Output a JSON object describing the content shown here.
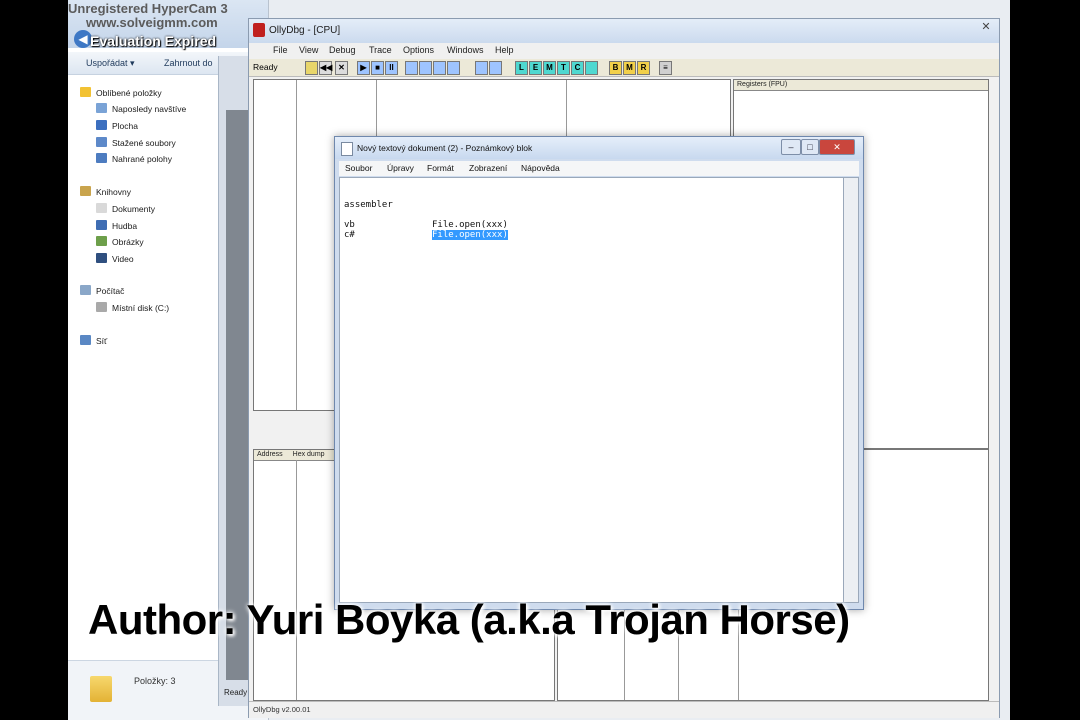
{
  "watermark": {
    "line1": "Unregistered HyperCam 3",
    "line2": "www.solveigmm.com",
    "line3": "Evaluation Expired"
  },
  "explorer": {
    "toolbar": {
      "organize": "Uspořádat ▾",
      "include": "Zahrnout do"
    },
    "favorites_header": "Oblíbené položky",
    "favorites": [
      "Naposledy navštíve",
      "Plocha",
      "Stažené soubory",
      "Nahrané polohy"
    ],
    "libraries_header": "Knihovny",
    "libraries": [
      "Dokumenty",
      "Hudba",
      "Obrázky",
      "Video"
    ],
    "computer_header": "Počítač",
    "computer_items": [
      "Místní disk (C:)"
    ],
    "network": "Síť",
    "status": "Položky: 3"
  },
  "olly": {
    "title": "OllyDbg - [CPU]",
    "menu": [
      "File",
      "View",
      "Debug",
      "Trace",
      "Options",
      "Windows",
      "Help"
    ],
    "toolbar_status": "Ready",
    "toolbar_buttons": [
      "◀◀",
      "✕",
      "▶",
      "■",
      "II",
      "L",
      "E",
      "M",
      "T",
      "C",
      "B",
      "M",
      "R"
    ],
    "registers_label": "Registers (FPU)",
    "address_label": "Address",
    "hex_label": "Hex dump",
    "bottom_ready": "Ready",
    "status_text": "OllyDbg v2.00.01"
  },
  "notepad": {
    "title": "Nový textový dokument (2) - Poznámkový blok",
    "menu": [
      "Soubor",
      "Úpravy",
      "Formát",
      "Zobrazení",
      "Nápověda"
    ],
    "lines": {
      "l1": "assembler",
      "l2a": "vb",
      "l2b": "File.open(xxx)",
      "l3a": "c#",
      "l3b": "File.open(xxx)"
    }
  },
  "author": "Author: Yuri Boyka (a.k.a Trojan Horse)",
  "colors": {
    "selection": "#3399ff",
    "olly_logo": "#c0201f",
    "title_bar": "#cbdaee"
  }
}
